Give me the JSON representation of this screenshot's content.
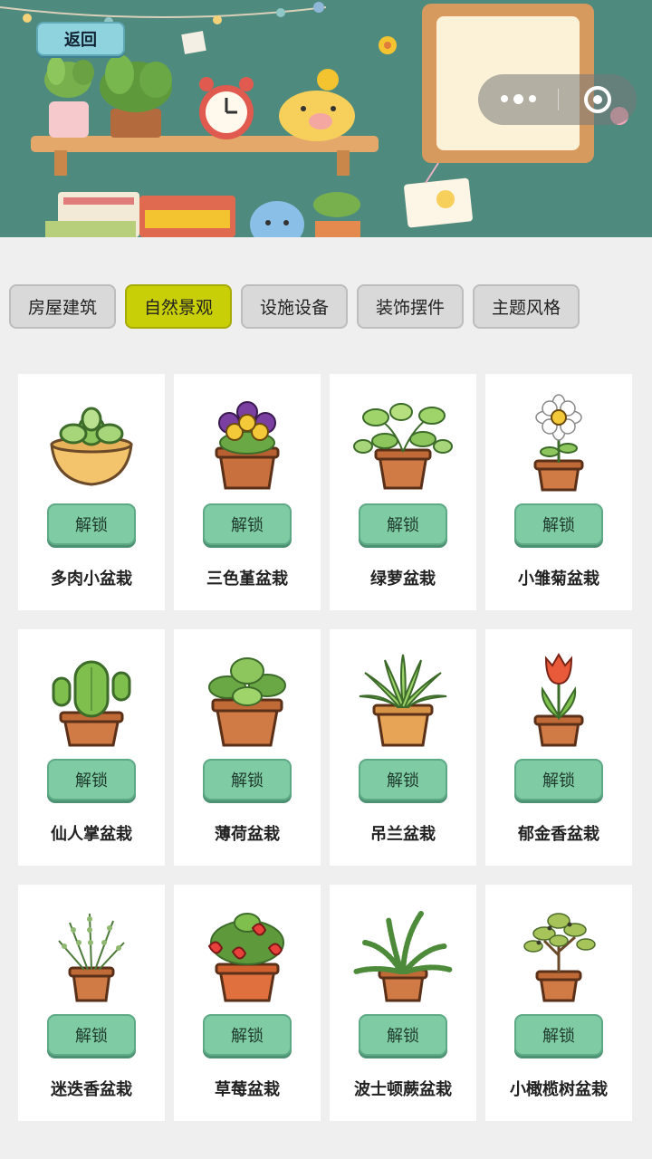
{
  "header": {
    "back_label": "返回"
  },
  "categories": [
    {
      "label": "房屋建筑",
      "active": false
    },
    {
      "label": "自然景观",
      "active": true
    },
    {
      "label": "设施设备",
      "active": false
    },
    {
      "label": "装饰摆件",
      "active": false
    },
    {
      "label": "主题风格",
      "active": false
    }
  ],
  "unlock_label": "解锁",
  "items": [
    {
      "name": "多肉小盆栽",
      "icon": "succulent-icon"
    },
    {
      "name": "三色堇盆栽",
      "icon": "pansy-icon"
    },
    {
      "name": "绿萝盆栽",
      "icon": "pothos-icon"
    },
    {
      "name": "小雏菊盆栽",
      "icon": "daisy-icon"
    },
    {
      "name": "仙人掌盆栽",
      "icon": "cactus-icon"
    },
    {
      "name": "薄荷盆栽",
      "icon": "mint-icon"
    },
    {
      "name": "吊兰盆栽",
      "icon": "spider-plant-icon"
    },
    {
      "name": "郁金香盆栽",
      "icon": "tulip-icon"
    },
    {
      "name": "迷迭香盆栽",
      "icon": "rosemary-icon"
    },
    {
      "name": "草莓盆栽",
      "icon": "strawberry-icon"
    },
    {
      "name": "波士顿蕨盆栽",
      "icon": "fern-icon"
    },
    {
      "name": "小橄榄树盆栽",
      "icon": "olive-tree-icon"
    }
  ],
  "colors": {
    "header_bg": "#4f8a7e",
    "active_tab": "#c9cf06",
    "unlock_button": "#7fcca4",
    "back_button": "#8fd3de"
  }
}
